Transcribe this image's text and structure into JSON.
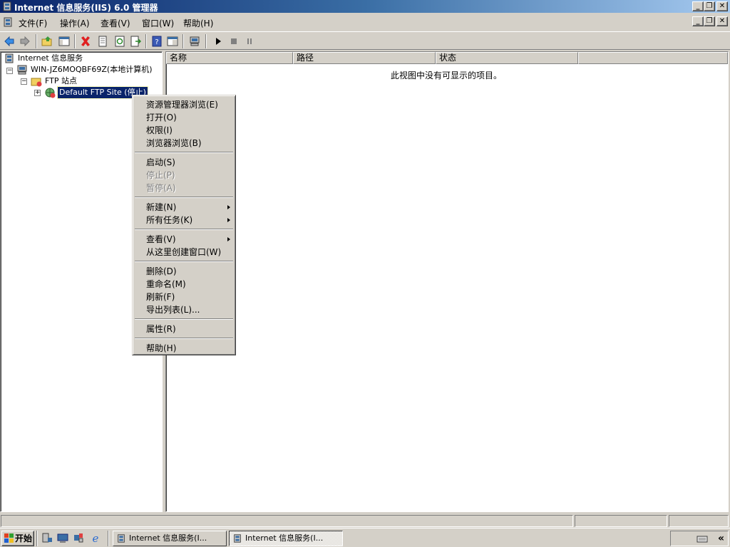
{
  "window": {
    "title": "Internet 信息服务(IIS) 6.0 管理器",
    "min": "_",
    "restore": "❐",
    "close": "✕"
  },
  "menubar": {
    "items": [
      "文件(F)",
      "操作(A)",
      "查看(V)",
      "窗口(W)",
      "帮助(H)"
    ]
  },
  "toolbar": {
    "icons": [
      "back-icon",
      "forward-icon",
      "up-folder-icon",
      "show-hide-tree-icon",
      "delete-icon",
      "properties-icon",
      "refresh-icon",
      "export-list-icon",
      "help-icon",
      "console-view-icon",
      "computer-icon",
      "start-icon",
      "stop-icon",
      "pause-icon"
    ]
  },
  "tree": {
    "root": "Internet 信息服务",
    "server": "WIN-JZ6MOQBF69Z(本地计算机)",
    "ftp_sites": "FTP 站点",
    "default_site": "Default FTP Site (停止)"
  },
  "list": {
    "columns": [
      "名称",
      "路径",
      "状态"
    ],
    "empty_message": "此视图中没有可显示的项目。"
  },
  "context_menu": {
    "groups": [
      [
        {
          "label": "资源管理器浏览(E)",
          "disabled": false,
          "submenu": false
        },
        {
          "label": "打开(O)",
          "disabled": false,
          "submenu": false
        },
        {
          "label": "权限(I)",
          "disabled": false,
          "submenu": false
        },
        {
          "label": "浏览器浏览(B)",
          "disabled": false,
          "submenu": false
        }
      ],
      [
        {
          "label": "启动(S)",
          "disabled": false,
          "submenu": false
        },
        {
          "label": "停止(P)",
          "disabled": true,
          "submenu": false
        },
        {
          "label": "暂停(A)",
          "disabled": true,
          "submenu": false
        }
      ],
      [
        {
          "label": "新建(N)",
          "disabled": false,
          "submenu": true
        },
        {
          "label": "所有任务(K)",
          "disabled": false,
          "submenu": true
        }
      ],
      [
        {
          "label": "查看(V)",
          "disabled": false,
          "submenu": true
        },
        {
          "label": "从这里创建窗口(W)",
          "disabled": false,
          "submenu": false
        }
      ],
      [
        {
          "label": "删除(D)",
          "disabled": false,
          "submenu": false
        },
        {
          "label": "重命名(M)",
          "disabled": false,
          "submenu": false
        },
        {
          "label": "刷新(F)",
          "disabled": false,
          "submenu": false
        },
        {
          "label": "导出列表(L)...",
          "disabled": false,
          "submenu": false
        }
      ],
      [
        {
          "label": "属性(R)",
          "disabled": false,
          "submenu": false
        }
      ],
      [
        {
          "label": "帮助(H)",
          "disabled": false,
          "submenu": false
        }
      ]
    ]
  },
  "taskbar": {
    "start": "开始",
    "buttons": [
      {
        "label": "Internet 信息服务(I...",
        "active": false
      },
      {
        "label": "Internet 信息服务(I...",
        "active": true
      }
    ],
    "tray_chevron": "«"
  },
  "colors": {
    "title_gradient_start": "#0a246a",
    "title_gradient_end": "#a6caf0",
    "selection": "#0a246a",
    "face": "#d4d0c8"
  }
}
